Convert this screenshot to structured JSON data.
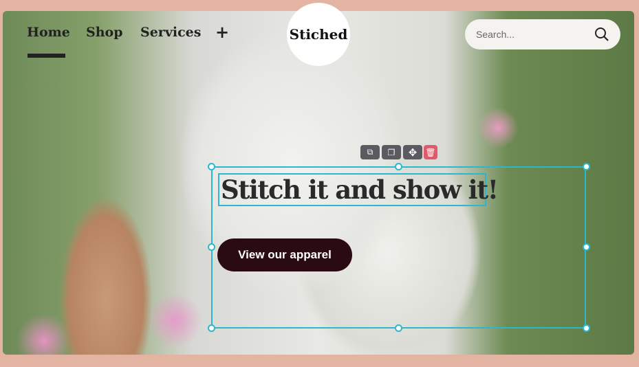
{
  "nav": {
    "items": [
      "Home",
      "Shop",
      "Services"
    ],
    "add": "+"
  },
  "logo": "Stiched",
  "search": {
    "placeholder": "Search..."
  },
  "hero": {
    "title": "Stitch it and show it!",
    "button": "View our apparel"
  },
  "toolbar": {
    "icons": [
      "duplicate-icon",
      "copy-icon",
      "move-icon",
      "trash-icon"
    ]
  }
}
